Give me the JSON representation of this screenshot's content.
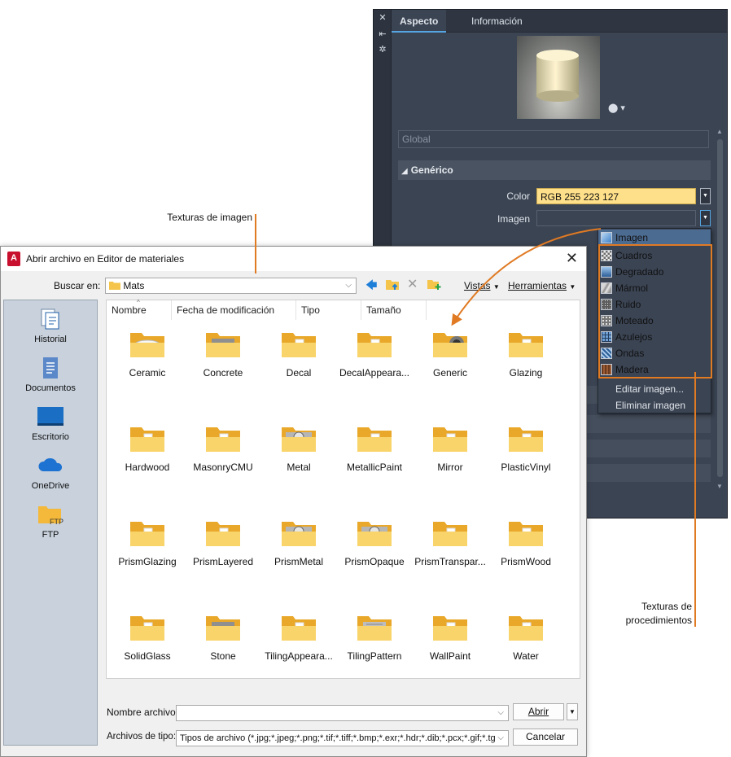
{
  "annotations": {
    "image_textures": "Texturas de imagen",
    "procedural_line1": "Texturas de",
    "procedural_line2": "procedimientos"
  },
  "material_editor": {
    "tabs": [
      "Aspecto",
      "Información"
    ],
    "global_placeholder": "Global",
    "section": "Genérico",
    "color_label": "Color",
    "color_value": "RGB 255 223 127",
    "image_label": "Imagen",
    "dropdown": {
      "items": [
        "Imagen",
        "Cuadros",
        "Degradado",
        "Mármol",
        "Ruido",
        "Moteado",
        "Azulejos",
        "Ondas",
        "Madera"
      ],
      "actions": [
        "Editar imagen...",
        "Eliminar imagen"
      ]
    }
  },
  "dialog": {
    "title": "Abrir archivo en Editor de materiales",
    "look_in_label": "Buscar en:",
    "look_in_value": "Mats",
    "views_label": "Vistas",
    "tools_label": "Herramientas",
    "sidebar": [
      "Historial",
      "Documentos",
      "Escritorio",
      "OneDrive",
      "FTP"
    ],
    "columns": [
      "Nombre",
      "Fecha de modificación",
      "Tipo",
      "Tamaño"
    ],
    "files": [
      "Ceramic",
      "Concrete",
      "Decal",
      "DecalAppeara...",
      "Generic",
      "Glazing",
      "Hardwood",
      "MasonryCMU",
      "Metal",
      "MetallicPaint",
      "Mirror",
      "PlasticVinyl",
      "PrismGlazing",
      "PrismLayered",
      "PrismMetal",
      "PrismOpaque",
      "PrismTranspar...",
      "PrismWood",
      "SolidGlass",
      "Stone",
      "TilingAppeara...",
      "TilingPattern",
      "WallPaint",
      "Water"
    ],
    "filename_label": "Nombre archivo:",
    "filename_value": "",
    "filetype_label": "Archivos de tipo:",
    "filetype_value": "Tipos de archivo  (*.jpg;*.jpeg;*.png;*.tif;*.tiff;*.bmp;*.exr;*.hdr;*.dib;*.pcx;*.gif;*.tga;",
    "open_button": "Abrir",
    "cancel_button": "Cancelar"
  }
}
